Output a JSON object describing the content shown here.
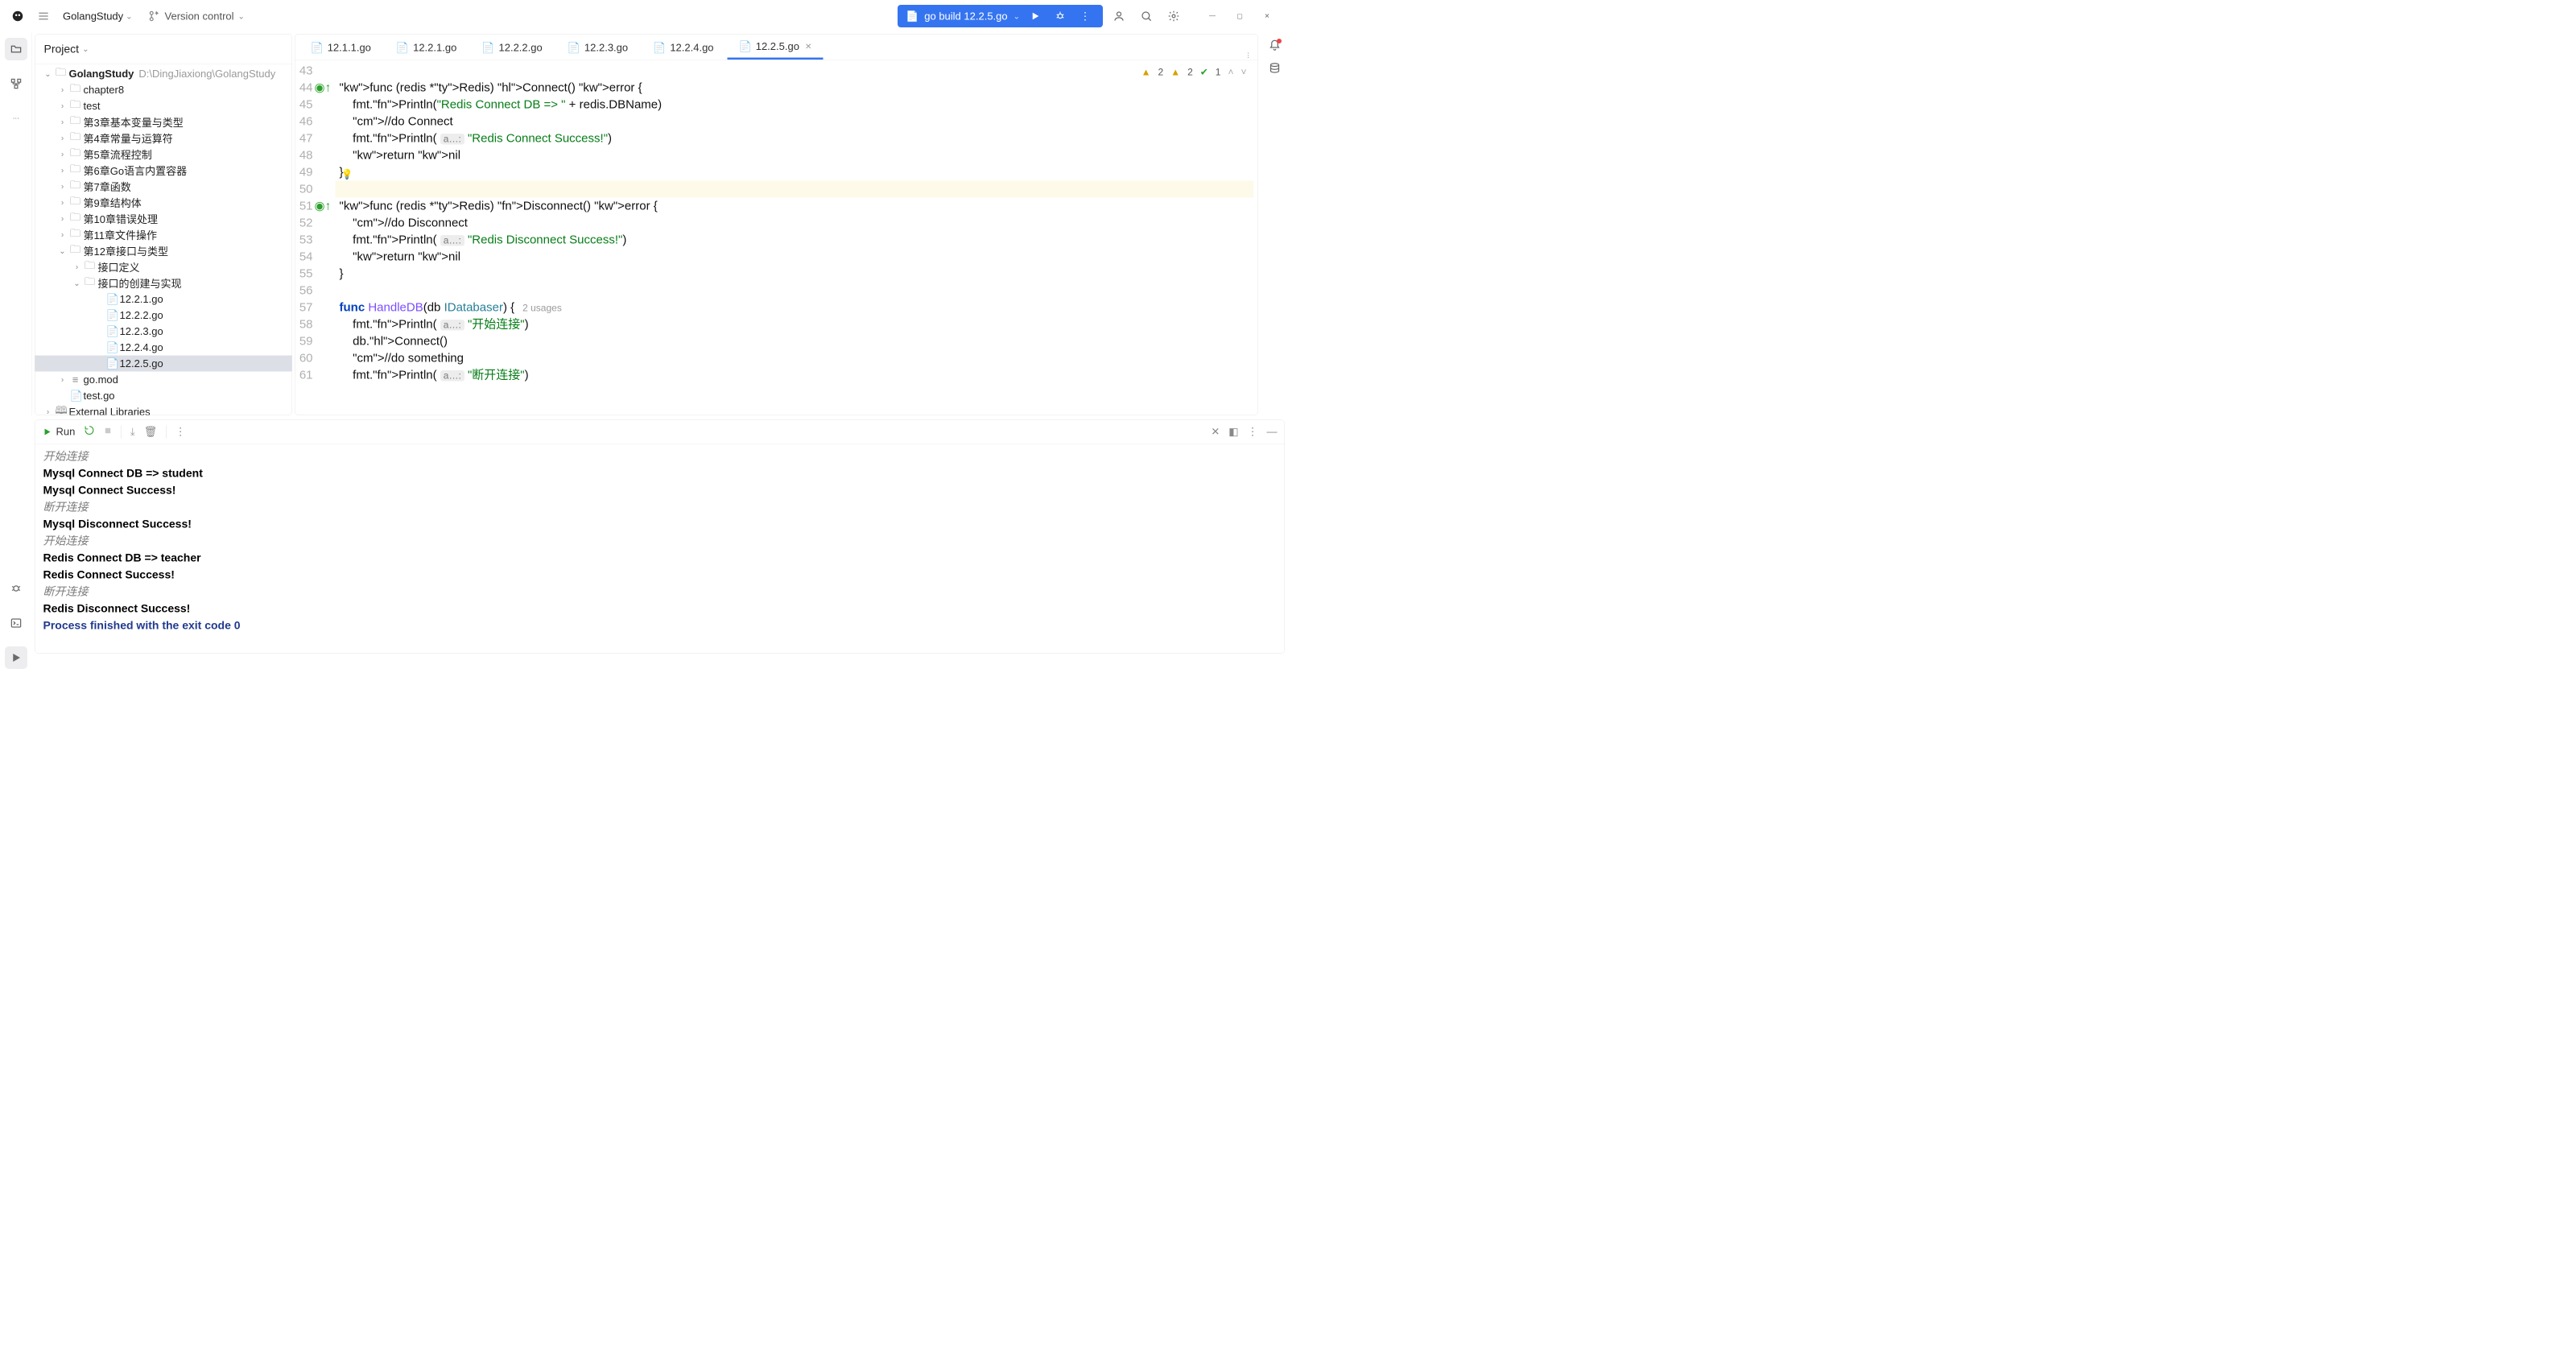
{
  "header": {
    "project": "GolangStudy",
    "vcs": "Version control",
    "run_config": "go build 12.2.5.go"
  },
  "project_panel": {
    "title": "Project",
    "root": "GolangStudy",
    "root_path": "D:\\DingJiaxiong\\GolangStudy",
    "folders": [
      "chapter8",
      "test",
      "第3章基本变量与类型",
      "第4章常量与运算符",
      "第5章流程控制",
      "第6章Go语言内置容器",
      "第7章函数",
      "第9章结构体",
      "第10章错误处理",
      "第11章文件操作"
    ],
    "ch12": "第12章接口与类型",
    "ch12_sub1": "接口定义",
    "ch12_sub2": "接口的创建与实现",
    "files": [
      "12.2.1.go",
      "12.2.2.go",
      "12.2.3.go",
      "12.2.4.go",
      "12.2.5.go"
    ],
    "go_mod": "go.mod",
    "test_go": "test.go",
    "ext_libs": "External Libraries"
  },
  "tabs": [
    "12.1.1.go",
    "12.2.1.go",
    "12.2.2.go",
    "12.2.3.go",
    "12.2.4.go",
    "12.2.5.go"
  ],
  "active_tab": 5,
  "gutter_start": 43,
  "inspections": {
    "warn1": "2",
    "warn2": "2",
    "ok": "1"
  },
  "code_lines": [
    "",
    "func (redis *Redis) Connect() error {",
    "    fmt.Println(\"Redis Connect DB => \" + redis.DBName)",
    "    //do Connect",
    "    fmt.Println( a…: \"Redis Connect Success!\")",
    "    return nil",
    "}",
    "",
    "func (redis *Redis) Disconnect() error {",
    "    //do Disconnect",
    "    fmt.Println( a…: \"Redis Disconnect Success!\")",
    "    return nil",
    "}",
    "",
    "func HandleDB(db IDatabaser) {   2 usages",
    "    fmt.Println( a…: \"开始连接\")",
    "    db.Connect()",
    "    //do something",
    "    fmt.Println( a…: \"断开连接\")"
  ],
  "run": {
    "title": "Run",
    "output": [
      {
        "t": "开始连接",
        "c": "gray"
      },
      {
        "t": "Mysql Connect DB => student",
        "c": "b"
      },
      {
        "t": "Mysql Connect Success!",
        "c": "b"
      },
      {
        "t": "断开连接",
        "c": "gray"
      },
      {
        "t": "Mysql Disconnect Success!",
        "c": "b"
      },
      {
        "t": "开始连接",
        "c": "gray"
      },
      {
        "t": "Redis Connect DB => teacher",
        "c": "b"
      },
      {
        "t": "Redis Connect Success!",
        "c": "b"
      },
      {
        "t": "断开连接",
        "c": "gray"
      },
      {
        "t": "Redis Disconnect Success!",
        "c": "b"
      },
      {
        "t": "",
        "c": ""
      },
      {
        "t": "Process finished with the exit code 0",
        "c": "end"
      }
    ]
  }
}
